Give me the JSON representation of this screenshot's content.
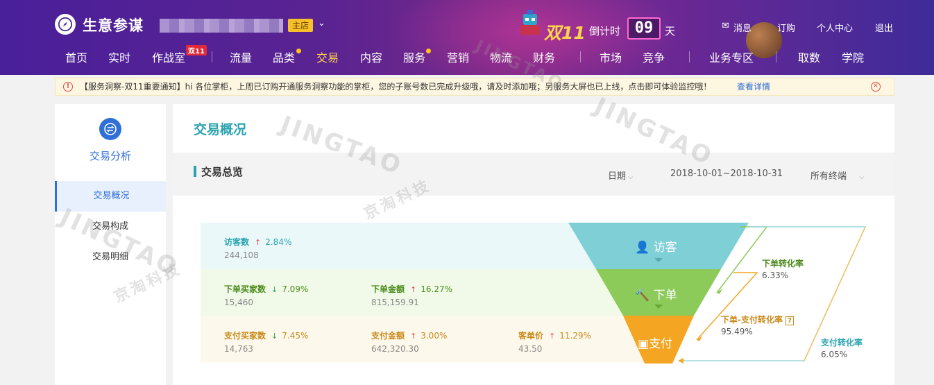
{
  "header": {
    "brand": "生意参谋",
    "main_badge": "主店",
    "promo": {
      "label": "双11",
      "countdown_label": "倒计时",
      "countdown_value": "09",
      "countdown_unit": "天"
    },
    "top_links": [
      "消息",
      "订购",
      "个人中心",
      "退出"
    ],
    "nav": [
      {
        "label": "首页"
      },
      {
        "label": "实时"
      },
      {
        "label": "作战室",
        "tag": "双11"
      },
      {
        "label": "流量"
      },
      {
        "label": "品类"
      },
      {
        "label": "交易",
        "active": true
      },
      {
        "label": "内容"
      },
      {
        "label": "服务"
      },
      {
        "label": "营销"
      },
      {
        "label": "物流"
      },
      {
        "label": "财务"
      },
      {
        "label": "市场"
      },
      {
        "label": "竞争"
      },
      {
        "label": "业务专区"
      },
      {
        "label": "取数"
      },
      {
        "label": "学院"
      }
    ]
  },
  "notice": {
    "text": "【服务洞察-双11重要通知】hi 各位掌柜，上周已订购开通服务洞察功能的掌柜，您的子账号数已完成升级哦，请及时添加哦；另服务大屏也已上线，点击即可体验监控哦！",
    "more": "查看详情"
  },
  "sidebar": {
    "title": "交易分析",
    "items": [
      {
        "label": "交易概况",
        "active": true
      },
      {
        "label": "交易构成"
      },
      {
        "label": "交易明细"
      }
    ]
  },
  "main": {
    "title": "交易概况",
    "section": {
      "title": "交易总览",
      "date_label": "日期",
      "date_range": "2018-10-01~2018-10-31",
      "terminal": "所有终端"
    },
    "rows": {
      "visitors": {
        "name": "访客数",
        "change": "2.84%",
        "dir": "up",
        "value": "244,108"
      },
      "order_buyers": {
        "name": "下单买家数",
        "change": "7.09%",
        "dir": "down",
        "value": "15,460"
      },
      "order_amount": {
        "name": "下单金额",
        "change": "16.27%",
        "dir": "up",
        "value": "815,159.91"
      },
      "pay_buyers": {
        "name": "支付买家数",
        "change": "7.45%",
        "dir": "down",
        "value": "14,763"
      },
      "pay_amount": {
        "name": "支付金额",
        "change": "3.00%",
        "dir": "up",
        "value": "642,320.30"
      },
      "unit_price": {
        "name": "客单价",
        "change": "11.29%",
        "dir": "up",
        "value": "43.50"
      }
    },
    "funnel": {
      "stages": [
        "访客",
        "下单",
        "支付"
      ],
      "colors": [
        "#7fcfd6",
        "#8ccb5a",
        "#f4a623"
      ]
    },
    "conversions": {
      "order": {
        "name": "下单转化率",
        "value": "6.33%"
      },
      "order_pay": {
        "name": "下单-支付转化率",
        "value": "95.49%"
      },
      "pay": {
        "name": "支付转化率",
        "value": "6.05%"
      }
    }
  },
  "watermark": {
    "en": "JINGTAO",
    "cn": "京淘科技"
  }
}
